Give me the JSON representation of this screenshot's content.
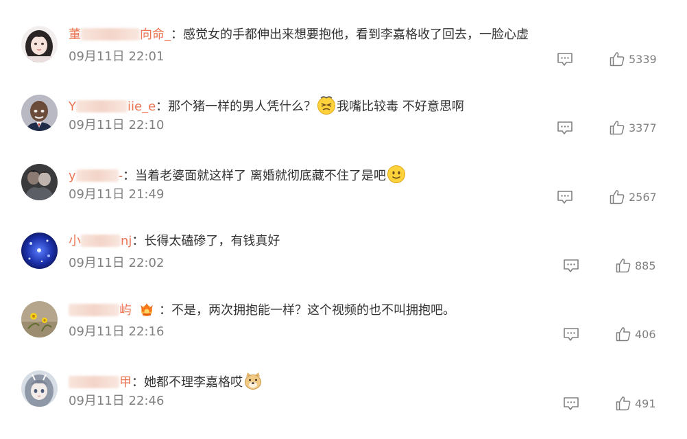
{
  "comments": [
    {
      "username_start": "董",
      "username_end": "向命_",
      "separator": "：",
      "text": "感觉女的手都伸出来想要抱他，看到李嘉格收了回去，一脸心虚",
      "time": "09月11日 22:01",
      "likes": "5339",
      "avatar_icon": "avatar-girl-photo-icon"
    },
    {
      "username_start": "Y",
      "username_end": "iie_e",
      "separator": "：",
      "text": "那个猪一样的男人凭什么？",
      "emoji": "dizzy-face-emoji-icon",
      "text_after": "我嘴比较毒 不好意思啊",
      "time": "09月11日 22:10",
      "likes": "3377",
      "avatar_icon": "avatar-boy-photo-icon"
    },
    {
      "username_start": "y",
      "username_end": "-",
      "separator": "：",
      "text": "当着老婆面就这样了 离婚就彻底藏不住了是吧",
      "emoji": "smile-face-emoji-icon",
      "time": "09月11日 21:49",
      "likes": "2567",
      "avatar_icon": "avatar-couple-photo-icon"
    },
    {
      "username_start": "小",
      "username_end": "nj",
      "separator": "：",
      "text": "长得太磕碜了，有钱真好",
      "time": "09月11日 22:02",
      "likes": "885",
      "avatar_icon": "avatar-blue-sparkle-icon"
    },
    {
      "username_start": "",
      "username_end": "屿",
      "separator": "：",
      "text": "不是，两次拥抱能一样？这个视频的也不叫拥抱吧。",
      "badge": "crown-badge-icon",
      "time": "09月11日 22:16",
      "likes": "406",
      "avatar_icon": "avatar-flower-photo-icon"
    },
    {
      "username_start": "",
      "username_end": "甲",
      "separator": "：",
      "text": "她都不理李嘉格哎",
      "emoji": "doge-emoji-icon",
      "time": "09月11日 22:46",
      "likes": "491",
      "avatar_icon": "avatar-anime-girl-icon"
    }
  ],
  "colors": {
    "username": "#eb7350",
    "text": "#333333",
    "meta": "#808080"
  }
}
